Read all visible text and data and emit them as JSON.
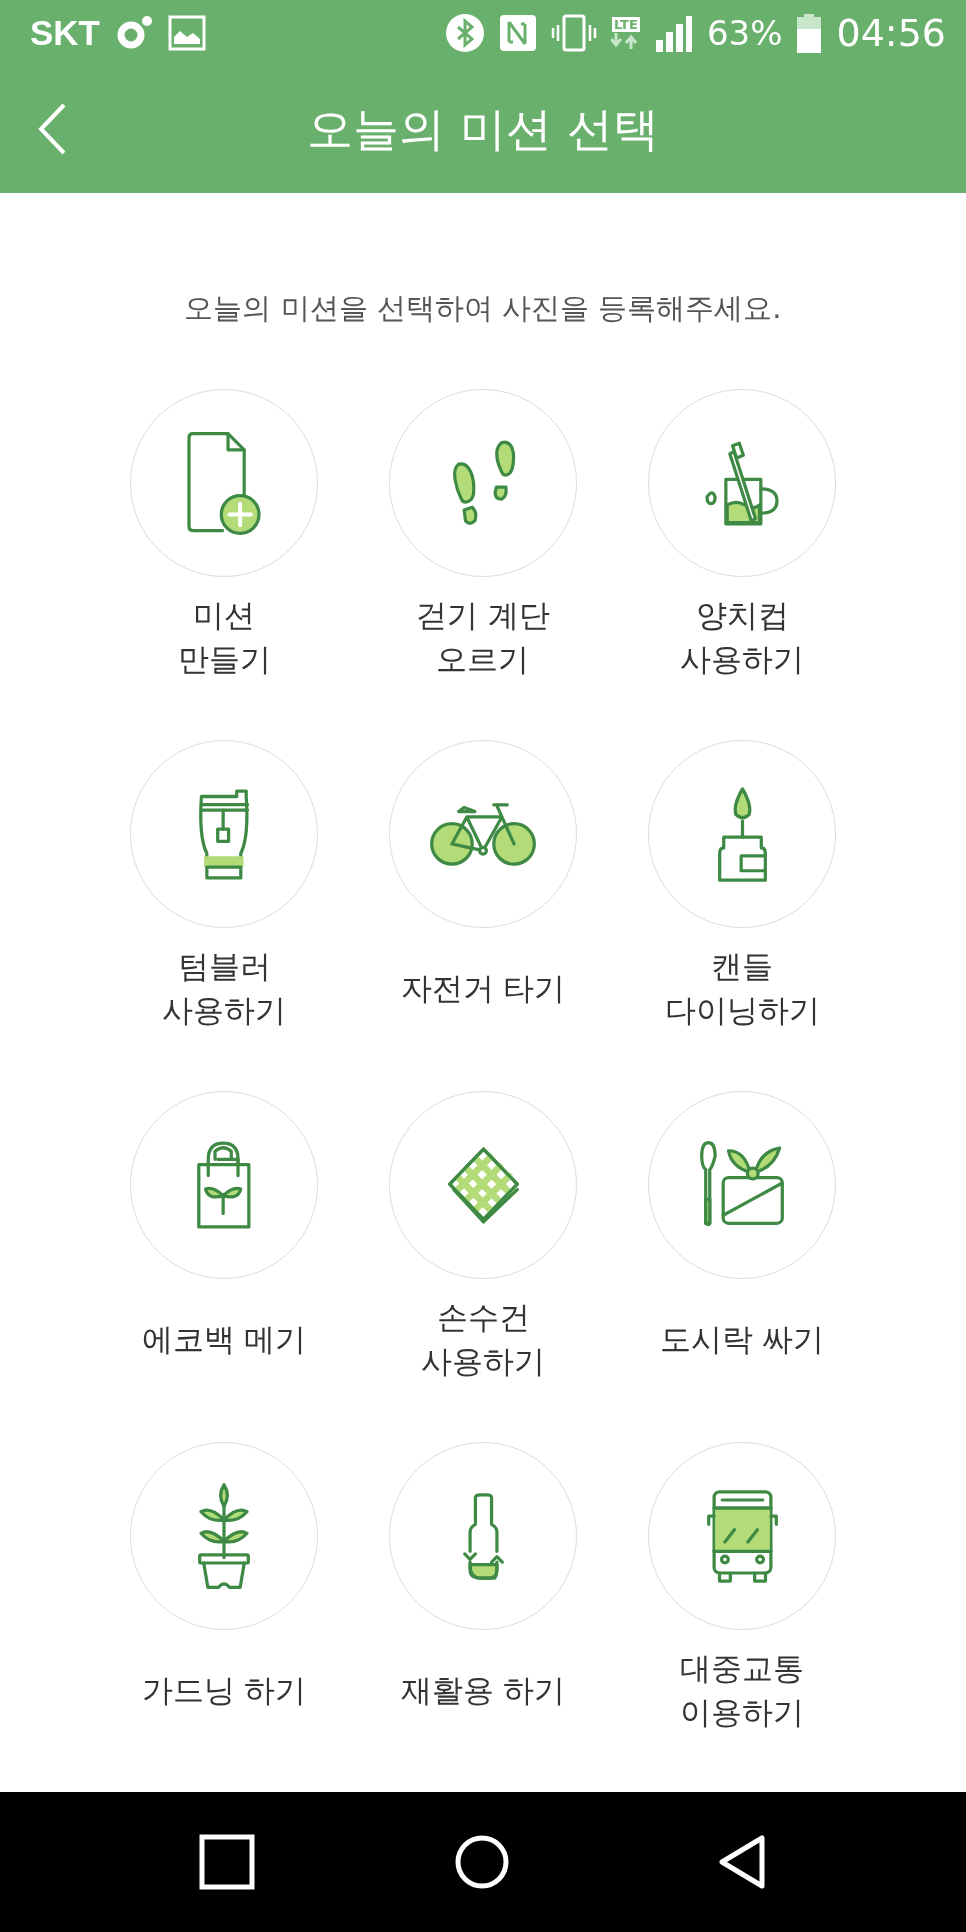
{
  "status_bar": {
    "carrier": "SKT",
    "network": "LTE",
    "battery": "63%",
    "time": "04:56"
  },
  "header": {
    "title": "오늘의 미션 선택"
  },
  "instruction": "오늘의 미션을 선택하여 사진을 등록해주세요.",
  "missions": [
    {
      "label": "미션\n만들기"
    },
    {
      "label": "걷기 계단\n오르기"
    },
    {
      "label": "양치컵\n사용하기"
    },
    {
      "label": "텀블러\n사용하기"
    },
    {
      "label": "자전거 타기"
    },
    {
      "label": "캔들\n다이닝하기"
    },
    {
      "label": "에코백 메기"
    },
    {
      "label": "손수건\n사용하기"
    },
    {
      "label": "도시락 싸기"
    },
    {
      "label": "가드닝 하기"
    },
    {
      "label": "재활용 하기"
    },
    {
      "label": "대중교통\n이용하기"
    }
  ]
}
